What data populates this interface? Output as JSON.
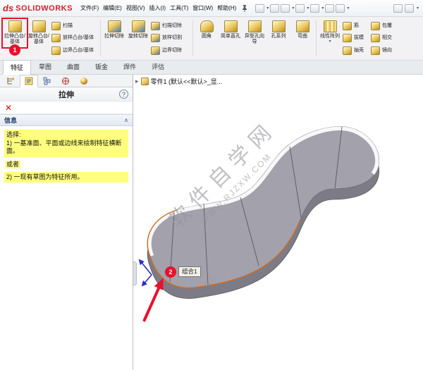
{
  "titlebar": {
    "logo_ds": "ds",
    "logo_text": "SOLIDWORKS",
    "menus": [
      "文件(F)",
      "编辑(E)",
      "视图(V)",
      "插入(I)",
      "工具(T)",
      "窗口(W)",
      "帮助(H)"
    ]
  },
  "ui": {
    "caret": "▾",
    "chevron_up": "∧",
    "help": "?",
    "close": "✕",
    "tree_arrow": "▸"
  },
  "ribbon": {
    "large": [
      {
        "label": "拉伸凸台/基体"
      },
      {
        "label": "旋转凸台/基体"
      },
      {
        "label": "拉伸切除"
      },
      {
        "label": "旋转切除"
      },
      {
        "label": "圆角"
      },
      {
        "label": "简单直孔"
      },
      {
        "label": "异型孔向导"
      },
      {
        "label": "孔系列"
      },
      {
        "label": "弯曲"
      },
      {
        "label": "线性阵列"
      }
    ],
    "stack1": [
      "扫描",
      "放样凸台/基体",
      "边界凸台/基体"
    ],
    "stack2": [
      "扫描切除",
      "放样切割",
      "边界切除"
    ],
    "stack3": [
      "筋",
      "拔模",
      "抽壳"
    ],
    "stack4": [
      "包覆",
      "相交",
      "镜向"
    ]
  },
  "tabs": {
    "items": [
      "特征",
      "草图",
      "曲面",
      "钣金",
      "焊件",
      "评估"
    ]
  },
  "panel": {
    "title": "拉伸",
    "info_header": "信息",
    "select_label": "选择:",
    "message1": "1) 一基准面、平面或边线来绘制特征横断面。",
    "or_label": "或者",
    "message2": "2) 一现有草图为特征所用。"
  },
  "viewport": {
    "tree_label": "零件1 (默认<<默认>_显...",
    "tooltip": "组合1",
    "watermark_line1": "软件自学网",
    "watermark_line2": "WWW.RJZXW.COM"
  },
  "annotations": {
    "step1": "1",
    "step2": "2"
  },
  "colors": {
    "annotation_red": "#e8112d",
    "highlight_yellow": "#ffff7d",
    "logo_red": "#d1202c"
  }
}
